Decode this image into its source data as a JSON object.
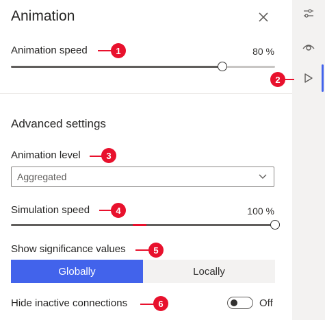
{
  "panel": {
    "title": "Animation",
    "animation_speed": {
      "label": "Animation speed",
      "value_text": "80 %",
      "value": 0.8
    },
    "advanced": {
      "heading": "Advanced settings",
      "animation_level": {
        "label": "Animation level",
        "selected": "Aggregated"
      },
      "simulation_speed": {
        "label": "Simulation speed",
        "value_text": "100 %",
        "value": 1.0
      },
      "significance": {
        "label": "Show significance values",
        "options": [
          "Globally",
          "Locally"
        ],
        "selected": "Globally"
      },
      "hide_inactive": {
        "label": "Hide inactive connections",
        "state": "Off"
      }
    }
  },
  "callouts": [
    "1",
    "2",
    "3",
    "4",
    "5",
    "6"
  ],
  "colors": {
    "accent": "#4263eb",
    "callout": "#e8112d"
  },
  "rail": {
    "icons": [
      "sliders-icon",
      "eye-icon",
      "play-icon"
    ],
    "active": "play-icon"
  }
}
